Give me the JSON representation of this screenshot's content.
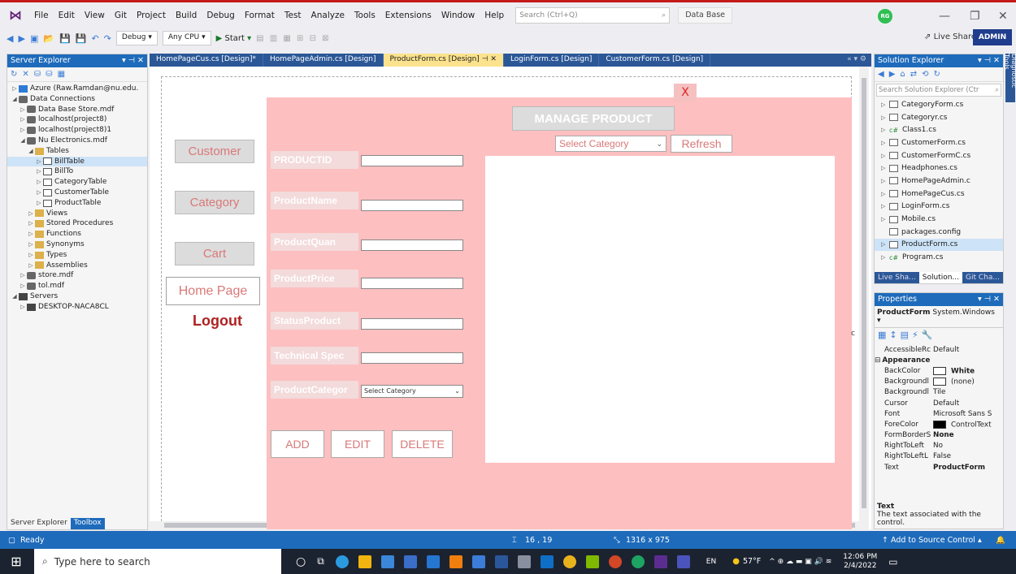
{
  "menubar": {
    "items": [
      "File",
      "Edit",
      "View",
      "Git",
      "Project",
      "Build",
      "Debug",
      "Format",
      "Test",
      "Analyze",
      "Tools",
      "Extensions",
      "Window",
      "Help"
    ],
    "search_placeholder": "Search (Ctrl+Q)",
    "project_name": "Data Base",
    "avatar_initials": "RG"
  },
  "toolbar": {
    "config": "Debug",
    "platform": "Any CPU",
    "start_label": "Start",
    "live_share": "Live Share",
    "admin_badge": "ADMIN"
  },
  "server_explorer": {
    "title": "Server Explorer",
    "tree": [
      {
        "indent": 0,
        "arrow": "▷",
        "icon": "azure",
        "label": "Azure (Raw.Ramdan@nu.edu."
      },
      {
        "indent": 0,
        "arrow": "◢",
        "icon": "db",
        "label": "Data Connections"
      },
      {
        "indent": 1,
        "arrow": "▷",
        "icon": "db",
        "label": "Data Base Store.mdf"
      },
      {
        "indent": 1,
        "arrow": "▷",
        "icon": "db",
        "label": "localhost(project8)"
      },
      {
        "indent": 1,
        "arrow": "▷",
        "icon": "db",
        "label": "localhost(project8)1"
      },
      {
        "indent": 1,
        "arrow": "◢",
        "icon": "db",
        "label": "Nu Electronics.mdf"
      },
      {
        "indent": 2,
        "arrow": "◢",
        "icon": "folder",
        "label": "Tables"
      },
      {
        "indent": 3,
        "arrow": "▷",
        "icon": "table",
        "label": "BillTable",
        "selected": true
      },
      {
        "indent": 3,
        "arrow": "▷",
        "icon": "table",
        "label": "BillTo"
      },
      {
        "indent": 3,
        "arrow": "▷",
        "icon": "table",
        "label": "CategoryTable"
      },
      {
        "indent": 3,
        "arrow": "▷",
        "icon": "table",
        "label": "CustomerTable"
      },
      {
        "indent": 3,
        "arrow": "▷",
        "icon": "table",
        "label": "ProductTable"
      },
      {
        "indent": 2,
        "arrow": "▷",
        "icon": "folder",
        "label": "Views"
      },
      {
        "indent": 2,
        "arrow": "▷",
        "icon": "folder",
        "label": "Stored Procedures"
      },
      {
        "indent": 2,
        "arrow": "▷",
        "icon": "folder",
        "label": "Functions"
      },
      {
        "indent": 2,
        "arrow": "▷",
        "icon": "folder",
        "label": "Synonyms"
      },
      {
        "indent": 2,
        "arrow": "▷",
        "icon": "folder",
        "label": "Types"
      },
      {
        "indent": 2,
        "arrow": "▷",
        "icon": "folder",
        "label": "Assemblies"
      },
      {
        "indent": 1,
        "arrow": "▷",
        "icon": "db",
        "label": "store.mdf"
      },
      {
        "indent": 1,
        "arrow": "▷",
        "icon": "db",
        "label": "tol.mdf"
      },
      {
        "indent": 0,
        "arrow": "◢",
        "icon": "srv",
        "label": "Servers"
      },
      {
        "indent": 1,
        "arrow": "▷",
        "icon": "srv",
        "label": "DESKTOP-NACA8CL"
      }
    ],
    "bottom_tabs": [
      "Server Explorer",
      "Toolbox"
    ]
  },
  "doc_tabs": [
    {
      "label": "HomePageCus.cs [Design]*",
      "active": false
    },
    {
      "label": "HomePageAdmin.cs [Design]",
      "active": false
    },
    {
      "label": "ProductForm.cs [Design]",
      "active": true
    },
    {
      "label": "LoginForm.cs [Design]",
      "active": false
    },
    {
      "label": "CustomerForm.cs [Design]",
      "active": false
    }
  ],
  "form": {
    "close_label": "X",
    "nav": {
      "customer": "Customer",
      "category": "Category",
      "cart": "Cart",
      "home": "Home Page",
      "logout": "Logout"
    },
    "fields": [
      {
        "label": "PRODUCTID"
      },
      {
        "label": "ProductName"
      },
      {
        "label": "ProductQuan"
      },
      {
        "label": "ProductPrice"
      },
      {
        "label": "StatusProduct"
      },
      {
        "label": "Technical Spec"
      },
      {
        "label": "ProductCategor"
      }
    ],
    "category_combo": "Select Category",
    "actions": {
      "add": "ADD",
      "edit": "EDIT",
      "delete": "DELETE"
    },
    "manage_title": "MANAGE PRODUCT",
    "filter_select": "Select Category",
    "refresh": "Refresh",
    "colors": {
      "panel": "#fdbfc0",
      "label_text": "#d97878",
      "logout": "#b02020"
    }
  },
  "solution_explorer": {
    "title": "Solution Explorer",
    "search_placeholder": "Search Solution Explorer (Ctr",
    "items": [
      {
        "label": "CategoryForm.cs",
        "type": "form"
      },
      {
        "label": "Categoryr.cs",
        "type": "form"
      },
      {
        "label": "Class1.cs",
        "type": "cs"
      },
      {
        "label": "CustomerForm.cs",
        "type": "form"
      },
      {
        "label": "CustomerFormC.cs",
        "type": "form"
      },
      {
        "label": "Headphones.cs",
        "type": "form"
      },
      {
        "label": "HomePageAdmin.c",
        "type": "form"
      },
      {
        "label": "HomePageCus.cs",
        "type": "form"
      },
      {
        "label": "LoginForm.cs",
        "type": "form"
      },
      {
        "label": "Mobile.cs",
        "type": "form"
      },
      {
        "label": "packages.config",
        "type": "config"
      },
      {
        "label": "ProductForm.cs",
        "type": "form",
        "selected": true
      },
      {
        "label": "Program.cs",
        "type": "cs"
      }
    ],
    "bottom_tabs": [
      "Live Sha...",
      "Solution...",
      "Git Cha..."
    ],
    "side_tab": "Diagnostic Tools"
  },
  "properties": {
    "title": "Properties",
    "object_name": "ProductForm",
    "object_type": "System.Windows",
    "rows": [
      {
        "name": "AccessibleRc",
        "value": "Default"
      },
      {
        "category": "Appearance"
      },
      {
        "name": "BackColor",
        "value": "White",
        "swatch": "#ffffff"
      },
      {
        "name": "Backgroundl",
        "value": "(none)",
        "swatch": "#ffffff"
      },
      {
        "name": "Backgroundl",
        "value": "Tile"
      },
      {
        "name": "Cursor",
        "value": "Default"
      },
      {
        "name": "Font",
        "value": "Microsoft Sans S"
      },
      {
        "name": "ForeColor",
        "value": "ControlText",
        "swatch": "#000000"
      },
      {
        "name": "FormBorderS",
        "value": "None"
      },
      {
        "name": "RightToLeft",
        "value": "No"
      },
      {
        "name": "RightToLeftL",
        "value": "False"
      },
      {
        "name": "Text",
        "value": "ProductForm"
      }
    ],
    "desc_title": "Text",
    "desc_text": "The text associated with the control."
  },
  "statusbar": {
    "ready": "Ready",
    "position": "16 , 19",
    "size": "1316 x 975",
    "source_control": "Add to Source Control"
  },
  "taskbar": {
    "search_placeholder": "Type here to search",
    "lang": "EN",
    "temp": "57°F",
    "time": "12:06 PM",
    "date": "2/4/2022"
  }
}
